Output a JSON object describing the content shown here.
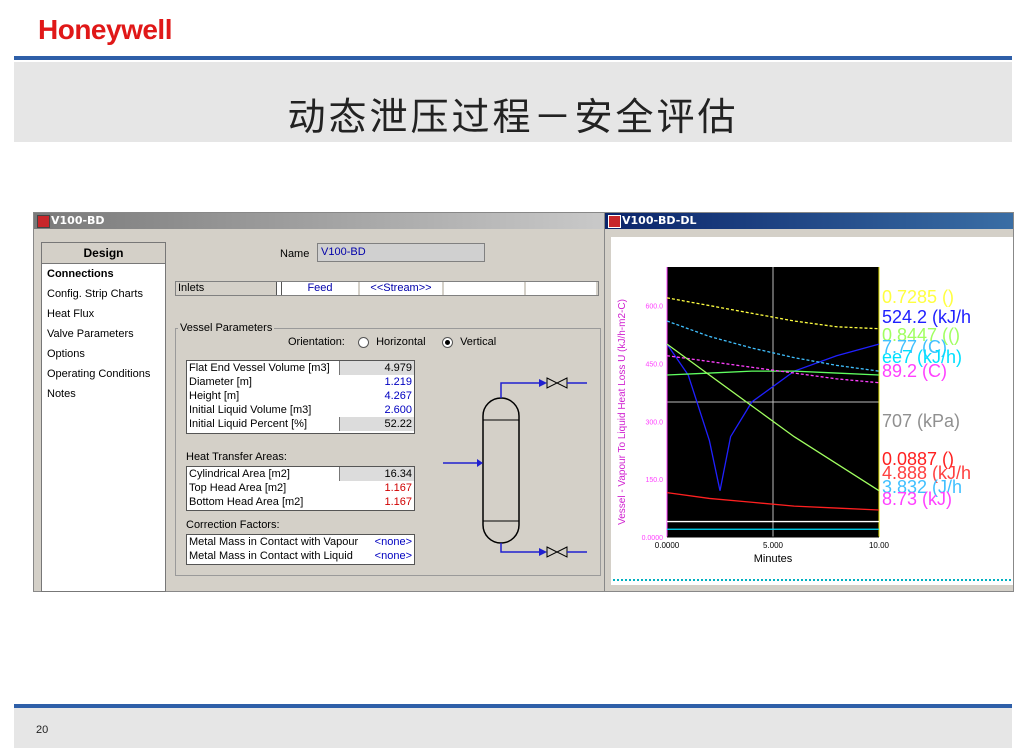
{
  "brand": "Honeywell",
  "slide_title": "动态泄压过程－安全评估",
  "page_number": "20",
  "design_window": {
    "title": "V100-BD",
    "nav_header": "Design",
    "nav_items": [
      "Connections",
      "Config. Strip Charts",
      "Heat Flux",
      "Valve Parameters",
      "Options",
      "Operating Conditions",
      "Notes"
    ],
    "name_label": "Name",
    "name_value": "V100-BD",
    "inlets_label": "Inlets",
    "inlets_feed": "Feed",
    "inlets_stream": "<<Stream>>",
    "vessel_params_label": "Vessel Parameters",
    "orientation_label": "Orientation:",
    "orientation_horizontal": "Horizontal",
    "orientation_vertical": "Vertical",
    "vessel_table": [
      {
        "k": "Flat End Vessel Volume [m3]",
        "v": "4.979"
      },
      {
        "k": "Diameter [m]",
        "v": "1.219"
      },
      {
        "k": "Height [m]",
        "v": "4.267"
      },
      {
        "k": "Initial Liquid Volume [m3]",
        "v": "2.600"
      },
      {
        "k": "Initial Liquid Percent [%]",
        "v": "52.22"
      }
    ],
    "heat_transfer_label": "Heat Transfer Areas:",
    "heat_table": [
      {
        "k": "Cylindrical Area [m2]",
        "v": "16.34"
      },
      {
        "k": "Top Head Area [m2]",
        "v": "1.167"
      },
      {
        "k": "Bottom Head Area [m2]",
        "v": "1.167"
      }
    ],
    "correction_label": "Correction Factors:",
    "correction_table": [
      {
        "k": "Metal Mass in Contact with Vapour",
        "v": "<none>"
      },
      {
        "k": "Metal Mass in Contact with Liquid",
        "v": "<none>"
      }
    ],
    "colors": {
      "value_blue": "#0000c0",
      "value_red": "#d00000"
    }
  },
  "chart_window": {
    "title": "V100-BD-DL",
    "chart_data": {
      "type": "line",
      "xlabel": "Minutes",
      "ylabel": "Vessel - Vapour To Liquid Heat Loss U (kJ/h-m2-C)",
      "x_ticks": [
        "0.0000",
        "5.000",
        "10.00"
      ],
      "y_ticks": [
        "0.0000",
        "150.0",
        "300.0",
        "450.0",
        "600.0"
      ],
      "xlim": [
        0,
        10
      ],
      "ylim": [
        0,
        700
      ],
      "series": [
        {
          "color": "#2020ff",
          "x": [
            0,
            1,
            2,
            2.5,
            3,
            4,
            6,
            8,
            10
          ],
          "values": [
            500,
            420,
            250,
            120,
            260,
            350,
            430,
            470,
            500
          ]
        },
        {
          "color": "#ffff40",
          "x": [
            0,
            2,
            4,
            6,
            8,
            10
          ],
          "values": [
            620,
            600,
            580,
            560,
            545,
            540
          ]
        },
        {
          "color": "#40c0ff",
          "x": [
            0,
            2,
            4,
            6,
            8,
            10
          ],
          "values": [
            560,
            520,
            490,
            465,
            445,
            430
          ]
        },
        {
          "color": "#60ff60",
          "x": [
            0,
            2,
            4,
            6,
            8,
            10
          ],
          "values": [
            420,
            425,
            430,
            430,
            425,
            420
          ]
        },
        {
          "color": "#ff40ff",
          "x": [
            0,
            2,
            4,
            6,
            8,
            10
          ],
          "values": [
            470,
            455,
            440,
            425,
            410,
            400
          ]
        },
        {
          "color": "#a0ff60",
          "x": [
            0,
            2,
            4,
            6,
            8,
            10
          ],
          "values": [
            500,
            420,
            340,
            260,
            190,
            120
          ]
        },
        {
          "color": "#ff2020",
          "x": [
            0,
            2,
            4,
            6,
            8,
            10
          ],
          "values": [
            115,
            100,
            90,
            80,
            75,
            70
          ]
        },
        {
          "color": "#ffffff",
          "x": [
            0,
            10
          ],
          "values": [
            40,
            40
          ]
        },
        {
          "color": "#00e0ff",
          "x": [
            0,
            10
          ],
          "values": [
            20,
            20
          ]
        }
      ],
      "labels": [
        {
          "text": "0.7285 ()",
          "color": "#ffff40"
        },
        {
          "text": "524.2 (kJ/h",
          "color": "#2020ff"
        },
        {
          "text": "0.8447 (()",
          "color": "#a0ff60"
        },
        {
          "text": "7.77 (C)",
          "color": "#40c0ff"
        },
        {
          "text": "ee7 (kJ/h)",
          "color": "#00e0ff"
        },
        {
          "text": "89.2 (C)",
          "color": "#ff40ff"
        },
        {
          "text": "707 (kPa)",
          "color": "#909090"
        },
        {
          "text": "0.0887 ()",
          "color": "#ff2020"
        },
        {
          "text": "4.888 (kJ/h",
          "color": "#ff4040"
        },
        {
          "text": "3.832 (J/h",
          "color": "#40c0ff"
        },
        {
          "text": "8.73 (kJ)",
          "color": "#ff40ff"
        }
      ]
    }
  }
}
